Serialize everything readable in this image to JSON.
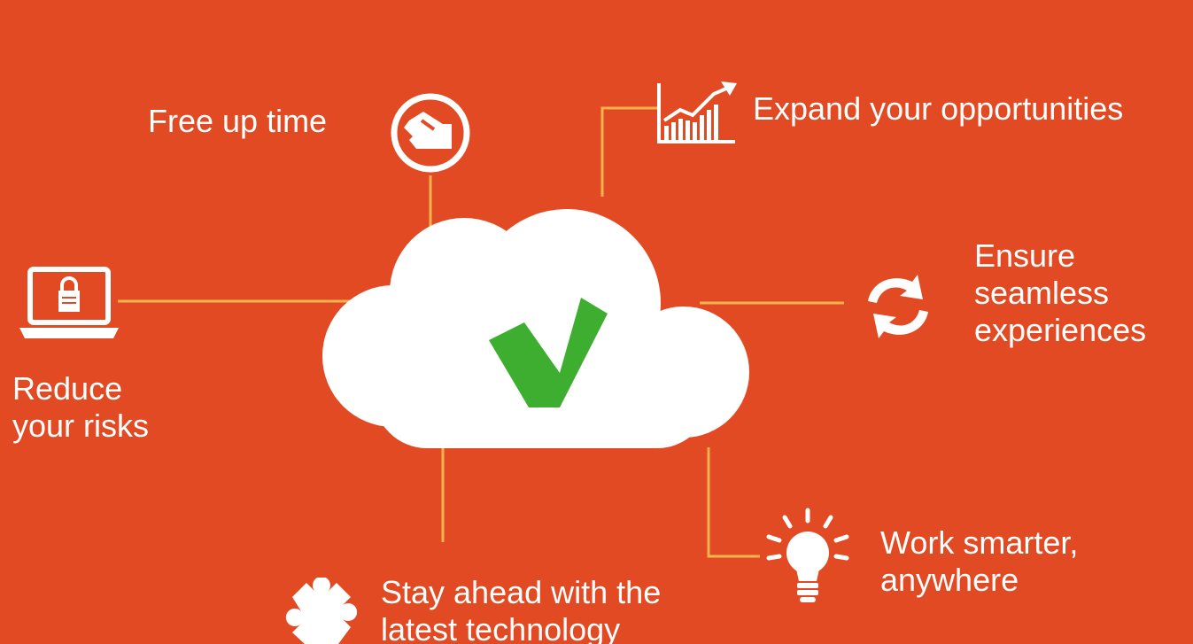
{
  "colors": {
    "background": "#E14A22",
    "connector": "#F7B34F",
    "cloud": "#FFFFFF",
    "check": "#3DAE2F",
    "text": "#FFFFFF"
  },
  "benefits": {
    "free_up_time": {
      "label": "Free up time",
      "icon": "hand-clock-icon"
    },
    "expand": {
      "label": "Expand your opportunities",
      "icon": "growth-chart-icon"
    },
    "ensure": {
      "lines": [
        "Ensure",
        "seamless",
        "experiences"
      ],
      "icon": "refresh-icon"
    },
    "reduce": {
      "lines": [
        "Reduce",
        "your risks"
      ],
      "icon": "laptop-lock-icon"
    },
    "stay_ahead": {
      "lines": [
        "Stay ahead with the",
        "latest technology"
      ],
      "icon": "puzzle-piece-icon"
    },
    "work_smarter": {
      "lines": [
        "Work smarter,",
        "anywhere"
      ],
      "icon": "lightbulb-icon"
    }
  },
  "center": {
    "icon": "cloud-icon",
    "badge": "checkmark-icon"
  }
}
